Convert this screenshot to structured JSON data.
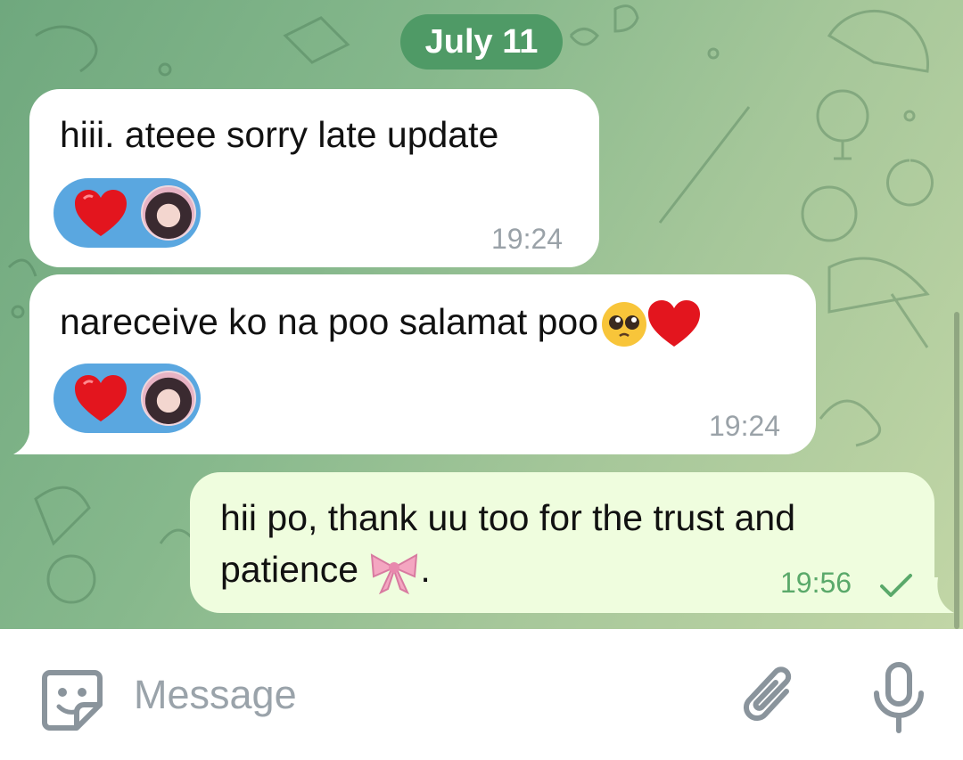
{
  "chat": {
    "date_label": "July 11",
    "messages": [
      {
        "direction": "incoming",
        "text": "hiii. ateee sorry late update",
        "reaction": "heart",
        "time": "19:24"
      },
      {
        "direction": "incoming",
        "text": "nareceive ko na poo salamat poo",
        "text_emojis": "pleading-face, red-heart",
        "reaction": "heart",
        "time": "19:24"
      },
      {
        "direction": "outgoing",
        "text_line1": "hii po, thank uu too for the trust and",
        "text_line2": "patience",
        "text_line2_suffix": ".",
        "text_emojis": "ribbon",
        "time": "19:56",
        "status": "sent-check"
      }
    ]
  },
  "input_bar": {
    "placeholder": "Message",
    "icons": [
      "sticker-icon",
      "attach-icon",
      "mic-icon"
    ]
  },
  "colors": {
    "date_pill": "#4f9a66",
    "incoming_bubble": "#ffffff",
    "outgoing_bubble": "#effdde",
    "reaction_pill": "#5aa7e0",
    "outgoing_time": "#5aa96a"
  }
}
